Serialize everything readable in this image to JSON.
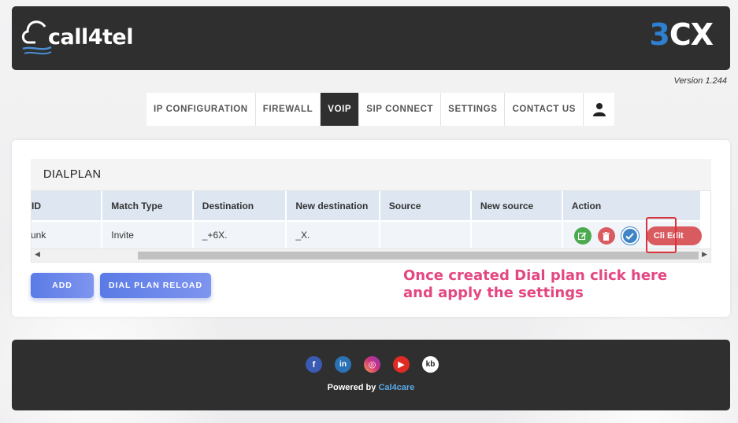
{
  "header": {
    "logo_left": "call4tel",
    "logo_right_accent": "3",
    "logo_right_rest": "CX",
    "version": "Version 1.244"
  },
  "nav": {
    "items": [
      {
        "label": "IP CONFIGURATION"
      },
      {
        "label": "FIREWALL"
      },
      {
        "label": "VOIP",
        "active": true
      },
      {
        "label": "SIP CONNECT"
      },
      {
        "label": "SETTINGS"
      },
      {
        "label": "CONTACT US"
      }
    ],
    "user_icon": "user-icon"
  },
  "dialplan": {
    "title": "DIALPLAN",
    "columns": [
      "ID",
      "Match Type",
      "Destination",
      "New destination",
      "Source",
      "New source",
      "Action"
    ],
    "rows": [
      {
        "id": "_trunk",
        "match_type": "Invite",
        "destination": "_+6X.",
        "new_destination": "_X.",
        "source": "",
        "new_source": "",
        "cli_edit_label": "Cli Edit"
      }
    ],
    "action_icons": [
      "edit-icon",
      "trash-icon",
      "check-icon"
    ],
    "add_label": "ADD",
    "reload_label": "DIAL PLAN RELOAD"
  },
  "annotation": {
    "text": "Once created Dial plan click here and apply the settings",
    "color": "#e34781"
  },
  "footer": {
    "social": [
      {
        "name": "facebook-icon",
        "glyph": "f"
      },
      {
        "name": "linkedin-icon",
        "glyph": "in"
      },
      {
        "name": "instagram-icon",
        "glyph": "◎"
      },
      {
        "name": "youtube-icon",
        "glyph": "▶"
      },
      {
        "name": "kb-icon",
        "glyph": "kb"
      }
    ],
    "powered_prefix": "Powered by ",
    "powered_brand": "Cal4care"
  },
  "colors": {
    "header_bg": "#2f2f2f",
    "accent_blue": "#2e7fcf",
    "button_gradient_start": "#5a7be6",
    "edit_green": "#4aaa4e",
    "delete_red": "#d95b5f",
    "apply_blue": "#3f84c5"
  }
}
